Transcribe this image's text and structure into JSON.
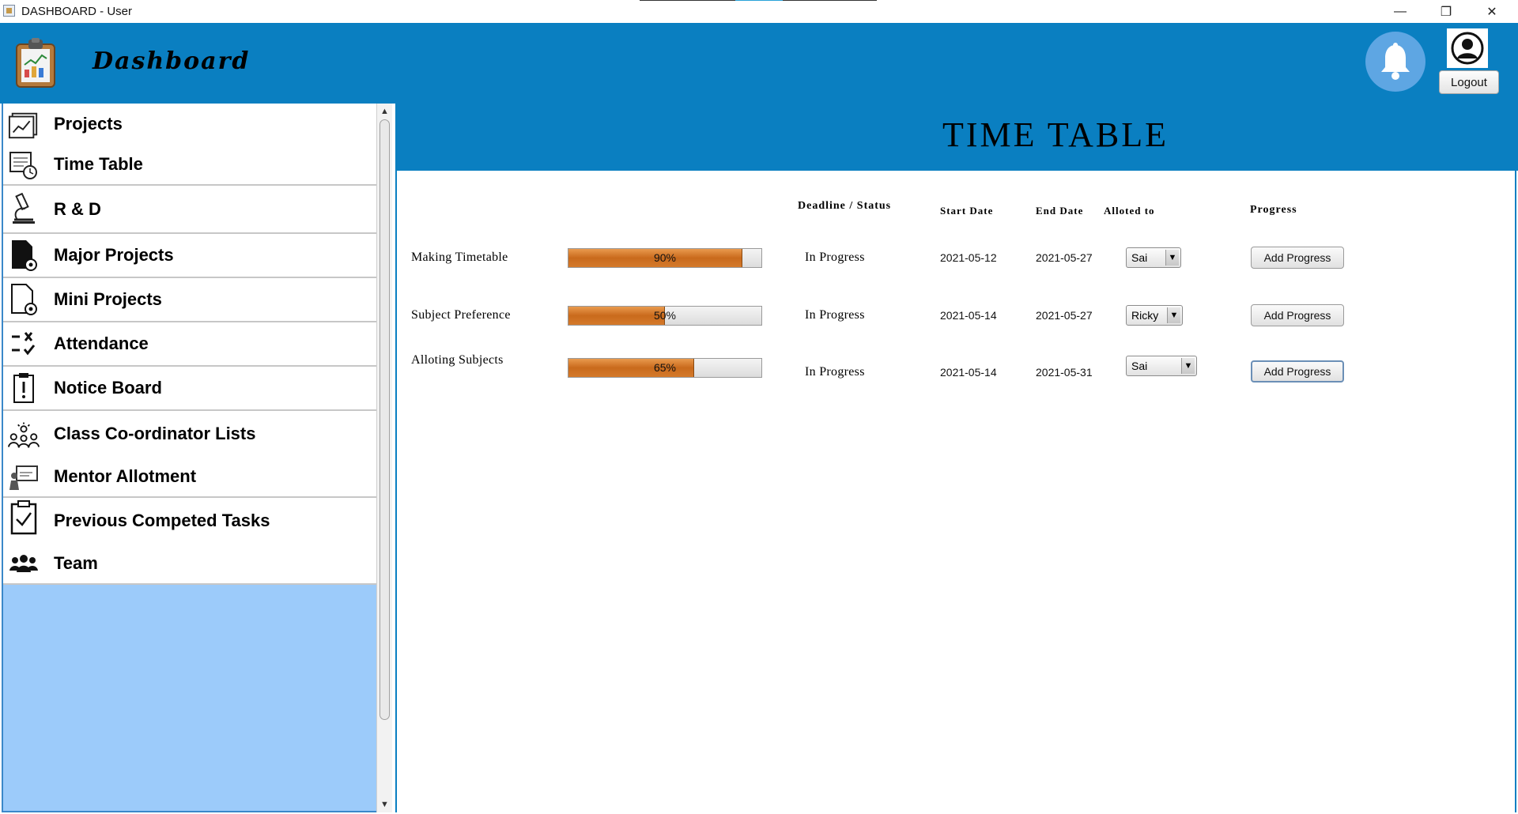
{
  "window": {
    "title": "DASHBOARD - User",
    "controls": {
      "minimize": "—",
      "maximize": "❐",
      "close": "✕"
    }
  },
  "header": {
    "brand": "Dashboard",
    "logout_label": "Logout",
    "icons": [
      "clipboard-chart-icon",
      "bell-icon",
      "user-avatar-icon"
    ],
    "accent_color": "#0a7fc1",
    "bell_color": "#5ea6e3"
  },
  "sidebar": {
    "background_color": "#9ccbfa",
    "items": [
      {
        "label": "Projects",
        "icon": "chart-document-icon"
      },
      {
        "label": "Time Table",
        "icon": "timetable-clock-icon"
      },
      {
        "label": "R & D",
        "icon": "microscope-icon"
      },
      {
        "label": "Major Projects",
        "icon": "file-gear-filled-icon"
      },
      {
        "label": "Mini Projects",
        "icon": "file-gear-outline-icon"
      },
      {
        "label": "Attendance",
        "icon": "check-cross-list-icon"
      },
      {
        "label": "Notice Board",
        "icon": "notice-exclamation-icon"
      },
      {
        "label": "Class Co-ordinator Lists",
        "icon": "group-idea-icon"
      },
      {
        "label": "Mentor Allotment",
        "icon": "presentation-board-icon"
      },
      {
        "label": "Previous Competed Tasks",
        "icon": "clipboard-check-icon"
      },
      {
        "label": "Team",
        "icon": "team-people-icon"
      }
    ]
  },
  "main": {
    "title": "TIME TABLE",
    "columns": {
      "deadline_status": "Deadline / Status",
      "start_date": "Start Date",
      "end_date": "End Date",
      "alloted_to": "Alloted to",
      "progress": "Progress"
    },
    "rows": [
      {
        "task": "Making Timetable",
        "progress": 90,
        "progress_label": "90%",
        "status": "In Progress",
        "start": "2021-05-12",
        "end": "2021-05-27",
        "alloted": "Sai",
        "button": "Add Progress"
      },
      {
        "task": "Subject Preference",
        "progress": 50,
        "progress_label": "50%",
        "status": "In Progress",
        "start": "2021-05-14",
        "end": "2021-05-27",
        "alloted": "Ricky",
        "button": "Add Progress"
      },
      {
        "task": "Alloting Subjects",
        "progress": 65,
        "progress_label": "65%",
        "status": "In Progress",
        "start": "2021-05-14",
        "end": "2021-05-31",
        "alloted": "Sai",
        "button": "Add Progress"
      }
    ],
    "progress_color": "#d47a2b"
  }
}
